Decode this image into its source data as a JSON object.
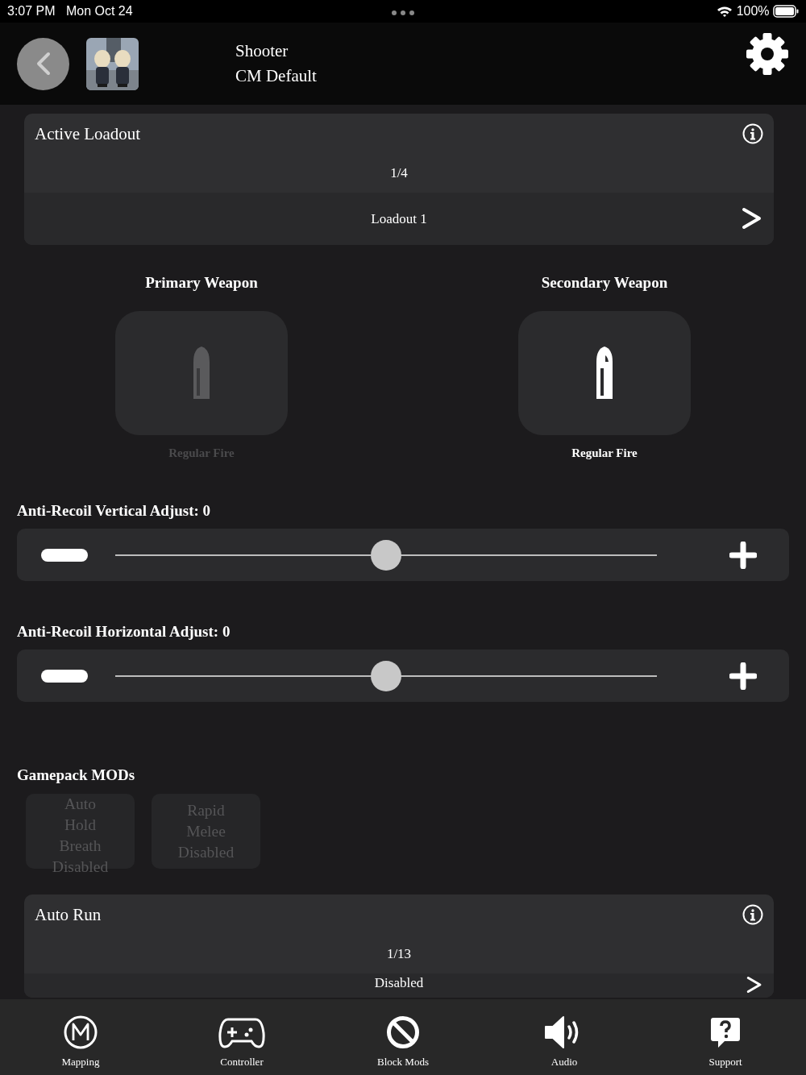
{
  "status_bar": {
    "time": "3:07 PM",
    "date": "Mon Oct 24",
    "battery": "100%"
  },
  "header": {
    "title": "Shooter",
    "subtitle": "CM Default"
  },
  "cards": [
    {
      "title": "Active Loadout",
      "count": "1/4",
      "value": "Loadout 1"
    }
  ],
  "weapons": [
    {
      "heading": "Primary Weapon",
      "caption": "Regular Fire",
      "enabled": false
    },
    {
      "heading": "Secondary Weapon",
      "caption": "Regular Fire",
      "enabled": true
    }
  ],
  "sliders": [
    {
      "label": "Anti-Recoil Vertical Adjust: 0",
      "level": 0.5
    },
    {
      "label": "Anti-Recoil Horizontal Adjust: 0",
      "level": 0.5
    }
  ],
  "mods": {
    "heading": "Gamepack MODs",
    "items": [
      {
        "label": "Auto Hold Breath Disabled",
        "enabled": false
      },
      {
        "label": "Rapid Melee Disabled",
        "enabled": false
      }
    ]
  },
  "auto_run": {
    "title": "Auto Run",
    "count": "1/13",
    "value": "Disabled"
  },
  "tab_bar": [
    {
      "kind": "mapping",
      "label": "Mapping"
    },
    {
      "kind": "controller",
      "label": "Controller"
    },
    {
      "kind": "block",
      "label": "Block Mods"
    },
    {
      "kind": "audio",
      "label": "Audio"
    },
    {
      "kind": "support",
      "label": "Support"
    }
  ]
}
